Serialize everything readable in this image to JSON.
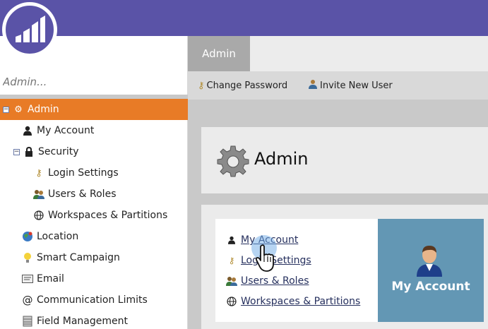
{
  "header": {
    "logo": "marketo-logo"
  },
  "search": {
    "placeholder": "Admin..."
  },
  "tree": [
    {
      "label": "Admin",
      "icon": "gear-icon",
      "selected": true
    },
    {
      "label": "My Account",
      "icon": "user-icon"
    },
    {
      "label": "Security",
      "icon": "lock-icon"
    },
    {
      "label": "Login Settings",
      "icon": "key-icon"
    },
    {
      "label": "Users & Roles",
      "icon": "users-icon"
    },
    {
      "label": "Workspaces & Partitions",
      "icon": "globe-icon"
    },
    {
      "label": "Location",
      "icon": "location-globe-icon"
    },
    {
      "label": "Smart Campaign",
      "icon": "lightbulb-icon"
    },
    {
      "label": "Email",
      "icon": "email-icon"
    },
    {
      "label": "Communication Limits",
      "icon": "at-icon"
    },
    {
      "label": "Field Management",
      "icon": "database-icon"
    }
  ],
  "tabs": {
    "active": "Admin"
  },
  "toolbar": {
    "change_password": "Change Password",
    "invite_user": "Invite New User"
  },
  "main": {
    "title": "Admin",
    "links": [
      "My Account",
      "Login Settings",
      "Users & Roles",
      "Workspaces & Partitions"
    ],
    "tile_label": "My Account"
  },
  "colors": {
    "topbar": "#5a53a7",
    "selected": "#e87b26",
    "tile": "#6397b4"
  }
}
